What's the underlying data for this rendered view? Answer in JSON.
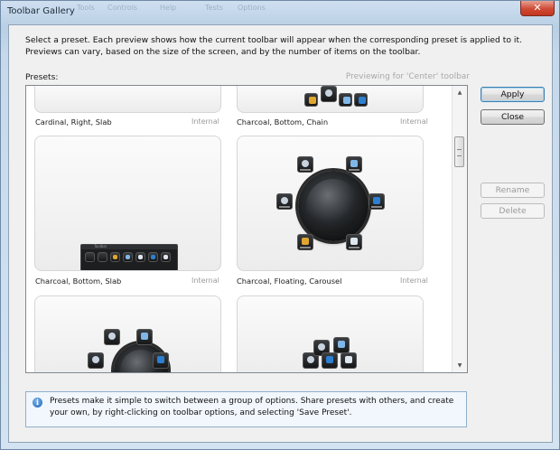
{
  "window": {
    "title": "Toolbar Gallery",
    "close_glyph": "✕",
    "background_ghost_menu": [
      "Tools",
      "Controls",
      "Help",
      "Tests",
      "Options"
    ]
  },
  "description": "Select a preset. Each preview shows how the current toolbar will appear when the corresponding preset is applied to it. Previews can vary, based on the size of the screen, and by the number of items on the toolbar.",
  "presets_label": "Presets:",
  "previewing_label": "Previewing for 'Center' toolbar",
  "presets": [
    {
      "name": "Cardinal, Right, Slab",
      "source": "Internal"
    },
    {
      "name": "Charcoal, Bottom, Chain",
      "source": "Internal"
    },
    {
      "name": "Charcoal, Bottom, Slab",
      "source": "Internal"
    },
    {
      "name": "Charcoal, Floating, Carousel",
      "source": "Internal"
    },
    {
      "name": "",
      "source": ""
    },
    {
      "name": "",
      "source": ""
    }
  ],
  "buttons": {
    "apply": "Apply",
    "close": "Close",
    "rename": "Rename",
    "delete": "Delete"
  },
  "slab_preview_title": "Toolbar",
  "info": {
    "icon": "i",
    "text": "Presets make it simple to switch between a group of options. Share presets with others, and create your own, by right-clicking on toolbar options, and selecting 'Save Preset'."
  },
  "colors": {
    "window_frame": "#b9cfe4",
    "close_button": "#cf4a35",
    "default_button_border": "#3c7fb1",
    "info_background": "#f1f7fc",
    "disabled_text": "#9a9a9a"
  }
}
